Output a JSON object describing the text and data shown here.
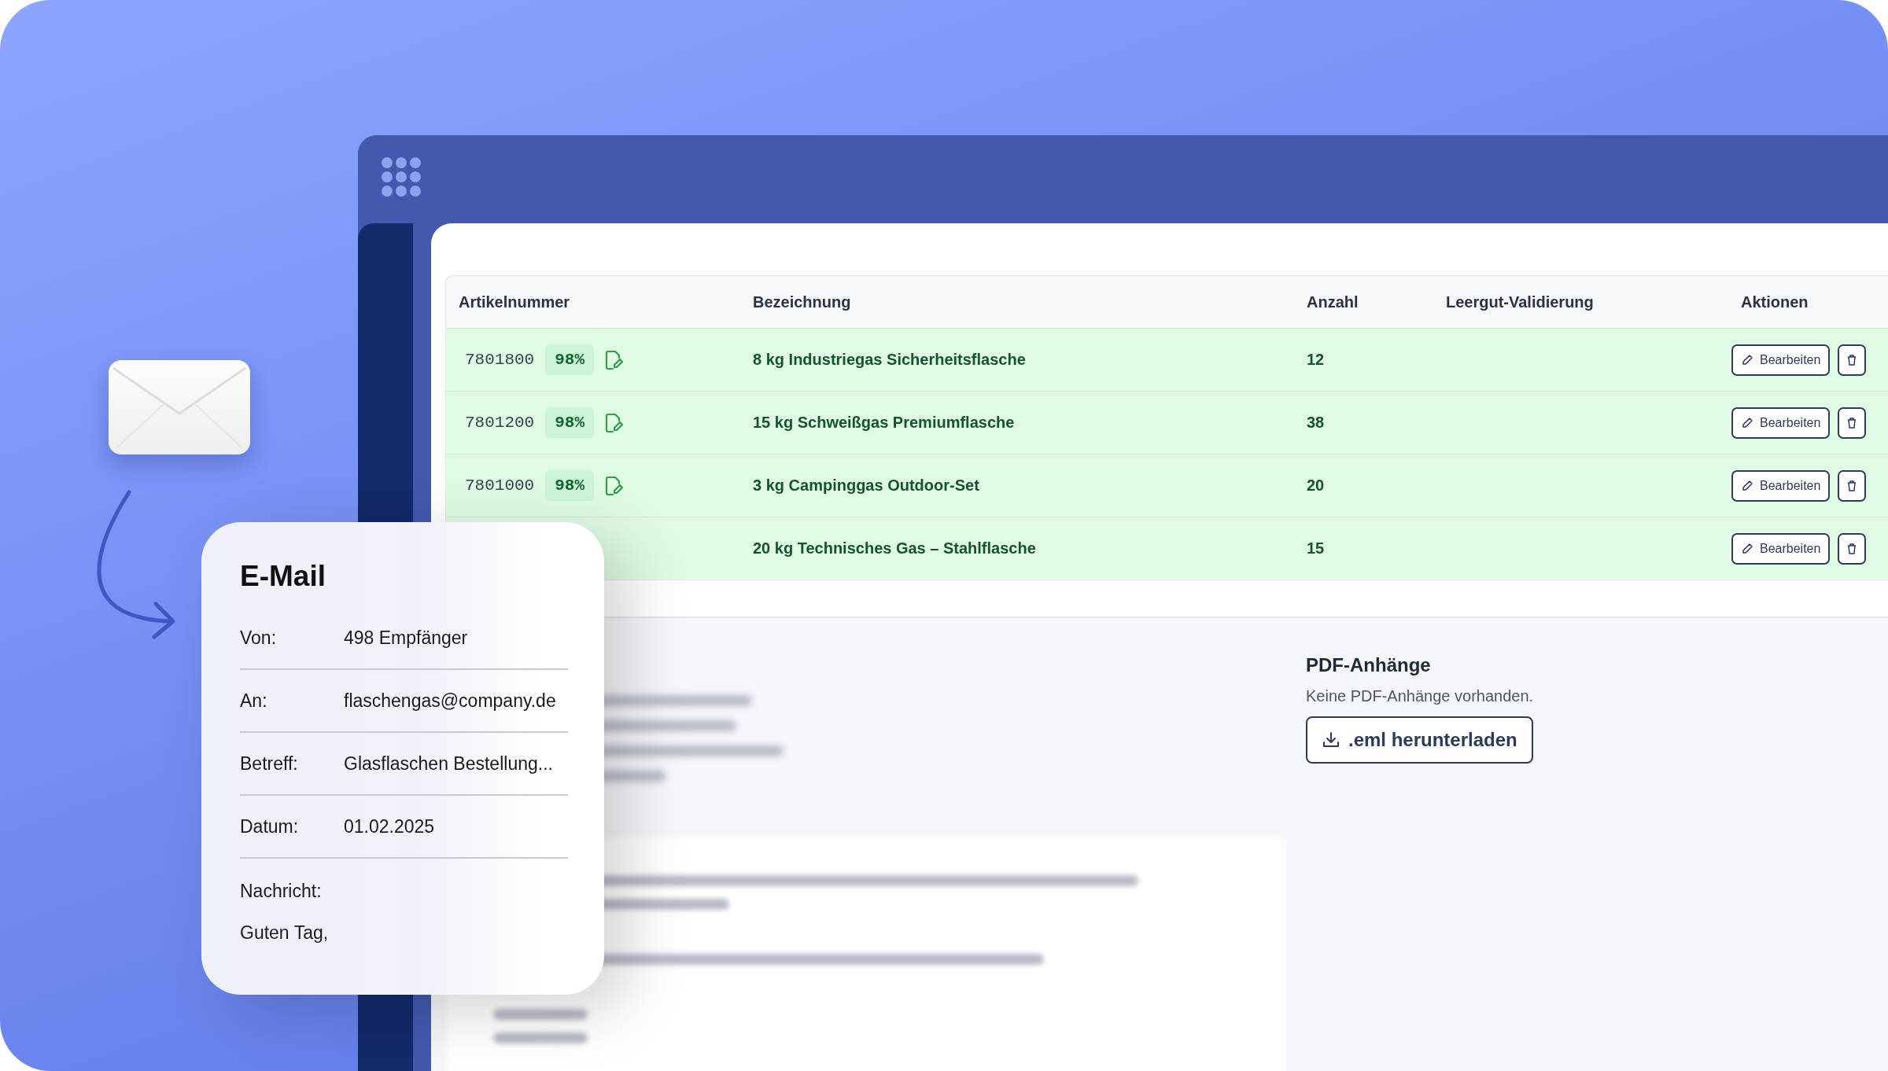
{
  "table": {
    "columns": [
      "Artikelnummer",
      "Bezeichnung",
      "Anzahl",
      "Leergut-Validierung",
      "Aktionen"
    ],
    "rows": [
      {
        "article": "7801800",
        "match": "98%",
        "name": "8 kg Industriegas Sicherheitsflasche",
        "quantity": "12",
        "edit": "Bearbeiten"
      },
      {
        "article": "7801200",
        "match": "98%",
        "name": "15 kg Schweißgas Premiumflasche",
        "quantity": "38",
        "edit": "Bearbeiten"
      },
      {
        "article": "7801000",
        "match": "98%",
        "name": "3 kg Campinggas Outdoor-Set",
        "quantity": "20",
        "edit": "Bearbeiten"
      },
      {
        "name": "20 kg Technisches Gas – Stahlflasche",
        "quantity": "15",
        "edit": "Bearbeiten"
      }
    ]
  },
  "attachments": {
    "title": "PDF-Anhänge",
    "empty_text": "Keine PDF-Anhänge vorhanden.",
    "download_button": ".eml herunterladen"
  },
  "email_card": {
    "title": "E-Mail",
    "fields": [
      {
        "label": "Von:",
        "value": "498 Empfänger"
      },
      {
        "label": "An:",
        "value": "flaschengas@company.de"
      },
      {
        "label": "Betreff:",
        "value": "Glasflaschen Bestellung..."
      },
      {
        "label": "Datum:",
        "value": "01.02.2025"
      }
    ],
    "message_label": "Nachricht:",
    "message": "Guten Tag,"
  }
}
